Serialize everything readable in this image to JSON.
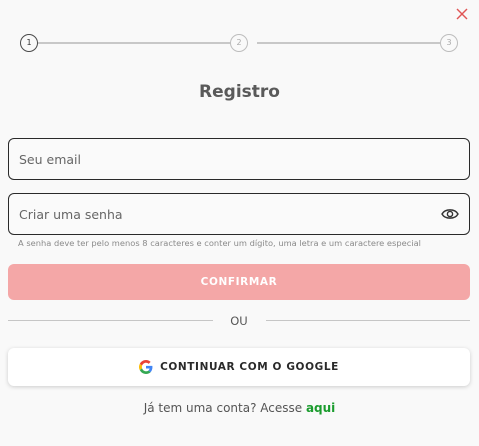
{
  "icons": {
    "close": "close-icon",
    "password_toggle": "eye-icon",
    "google": "google-icon"
  },
  "colors": {
    "accent": "#f4a7a7",
    "close_icon": "#e05555",
    "link": "#1b9c2e"
  },
  "stepper": {
    "steps": [
      {
        "label": "1",
        "active": true
      },
      {
        "label": "2",
        "active": false
      },
      {
        "label": "3",
        "active": false
      }
    ]
  },
  "form": {
    "title": "Registro",
    "email_placeholder": "Seu email",
    "email_value": "",
    "password_placeholder": "Criar uma senha",
    "password_value": "",
    "password_hint": "A senha deve ter pelo menos 8 caracteres e conter um dígito, uma letra e um caractere especial",
    "confirm_label": "CONFIRMAR",
    "divider_text": "OU",
    "google_label": "CONTINUAR COM O GOOGLE",
    "footer_text": "Já tem uma conta? Acesse",
    "footer_link": "aqui"
  }
}
